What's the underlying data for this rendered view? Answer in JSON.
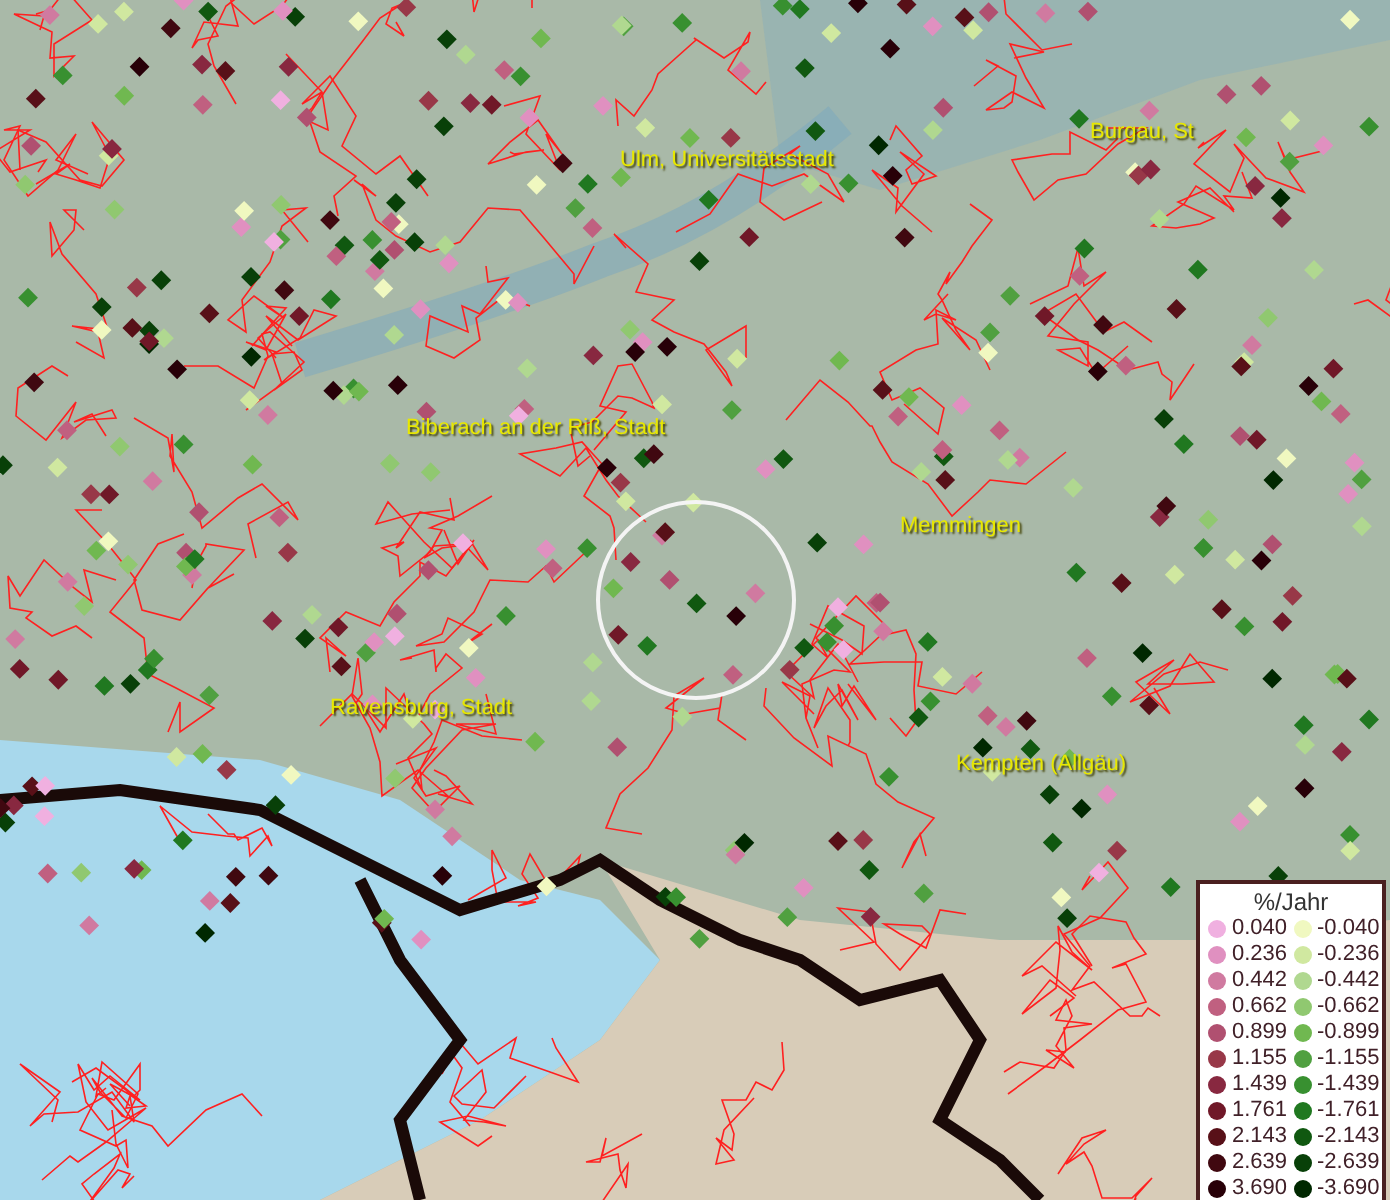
{
  "map": {
    "places": [
      {
        "name": "Ulm, Universitätsstadt"
      },
      {
        "name": "Burgau, St"
      },
      {
        "name": "Biberach an der Riß, Stadt"
      },
      {
        "name": "Memmingen"
      },
      {
        "name": "Ravensburg, Stadt"
      },
      {
        "name": "Kempten (Allgäu)"
      }
    ]
  },
  "legend": {
    "title": "%/Jahr",
    "columns": [
      [
        {
          "label": "0.040",
          "color": "#f0b0e0"
        },
        {
          "label": "0.236",
          "color": "#e090c0"
        },
        {
          "label": "0.442",
          "color": "#d07aa0"
        },
        {
          "label": "0.662",
          "color": "#c06080"
        },
        {
          "label": "0.899",
          "color": "#b05070"
        },
        {
          "label": "1.155",
          "color": "#983848"
        },
        {
          "label": "1.439",
          "color": "#882840"
        },
        {
          "label": "1.761",
          "color": "#701828"
        },
        {
          "label": "2.143",
          "color": "#581018"
        },
        {
          "label": "2.639",
          "color": "#400810"
        },
        {
          "label": "3.690",
          "color": "#280008"
        }
      ],
      [
        {
          "label": "-0.040",
          "color": "#f0f8c0"
        },
        {
          "label": "-0.236",
          "color": "#d0e8a0"
        },
        {
          "label": "-0.442",
          "color": "#b0d890"
        },
        {
          "label": "-0.662",
          "color": "#90c870"
        },
        {
          "label": "-0.899",
          "color": "#70b850"
        },
        {
          "label": "-1.155",
          "color": "#50a040"
        },
        {
          "label": "-1.439",
          "color": "#389030"
        },
        {
          "label": "-1.761",
          "color": "#207820"
        },
        {
          "label": "-2.143",
          "color": "#105810"
        },
        {
          "label": "-2.639",
          "color": "#084008"
        },
        {
          "label": "-3.690",
          "color": "#002800"
        }
      ]
    ]
  }
}
